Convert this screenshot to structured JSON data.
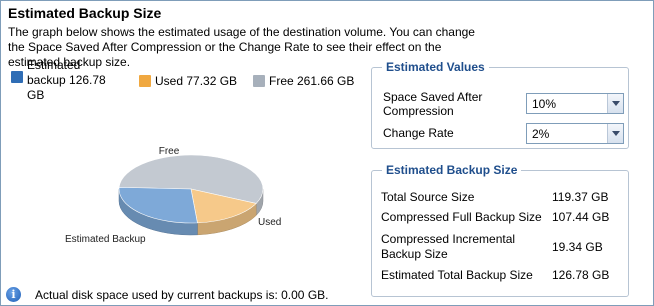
{
  "page": {
    "title": "Estimated Backup Size",
    "description": "The graph below shows the estimated usage of the destination volume. You can change the Space Saved After Compression or the Change Rate to see their effect on the estimated backup size."
  },
  "legend": {
    "estimated": "Estimated backup 126.78 GB",
    "used": "Used 77.32 GB",
    "free": "Free 261.66 GB"
  },
  "chart_data": {
    "type": "pie",
    "slices": [
      {
        "label": "Free",
        "value": 261.66,
        "color": "#c3c9d1"
      },
      {
        "label": "Used",
        "value": 77.32,
        "color": "#f6c98a"
      },
      {
        "label": "Estimated Backup",
        "value": 126.78,
        "color": "#7ea9d8"
      }
    ]
  },
  "colors": {
    "estimated": "#2f6db5",
    "used": "#f0a840",
    "free": "#a7b0bb"
  },
  "estimated_values": {
    "legend": "Estimated Values",
    "space_saved_label": "Space Saved After Compression",
    "space_saved_value": "10%",
    "change_rate_label": "Change Rate",
    "change_rate_value": "2%"
  },
  "estimated_size": {
    "legend": "Estimated Backup Size",
    "rows": [
      {
        "label": "Total Source Size",
        "value": "119.37 GB"
      },
      {
        "label": "Compressed Full Backup Size",
        "value": "107.44 GB"
      },
      {
        "label": "Compressed Incremental Backup Size",
        "value": "19.34 GB"
      },
      {
        "label": "Estimated Total Backup Size",
        "value": "126.78 GB"
      }
    ]
  },
  "footer": {
    "icon": "info-icon",
    "text": "Actual disk space used by current backups is: 0.00 GB."
  }
}
